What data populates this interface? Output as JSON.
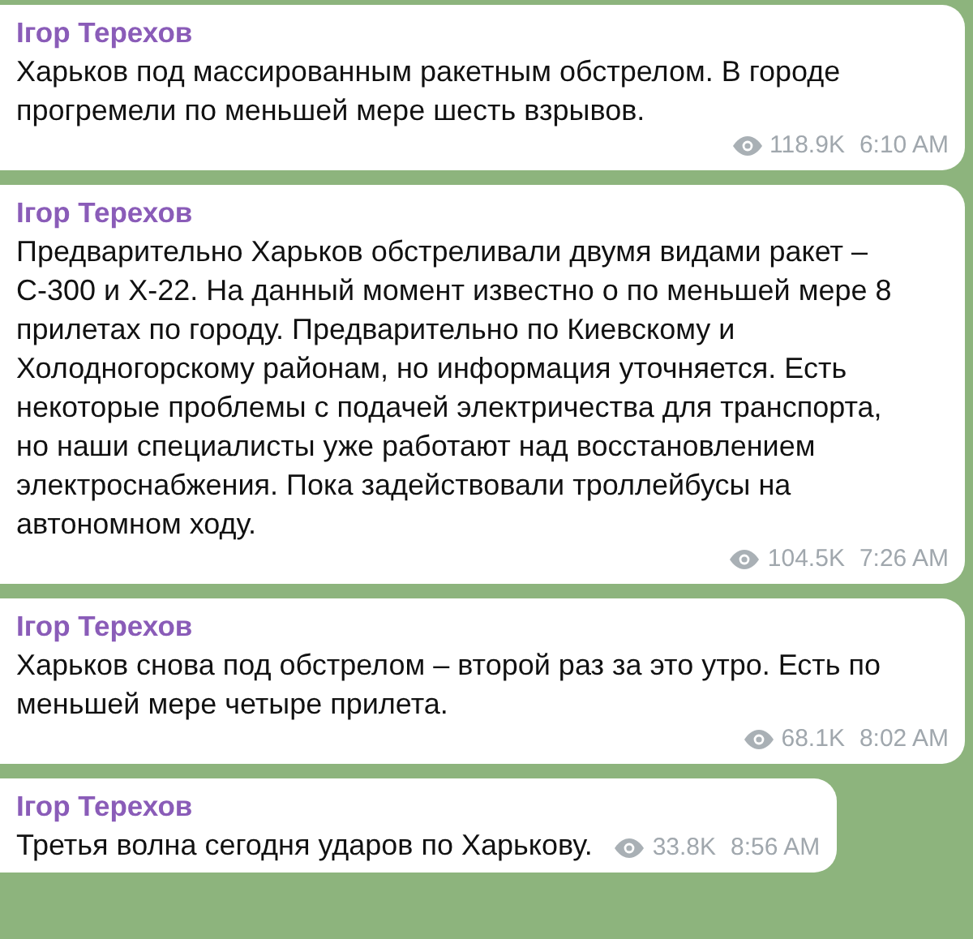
{
  "messages": [
    {
      "author": "Ігор Терехов",
      "text": "Харьков под массированным ракетным обстрелом. В городе\nпрогремели по меньшей мере шесть взрывов.",
      "views": "118.9K",
      "time": "6:10 AM"
    },
    {
      "author": "Ігор Терехов",
      "text": "Предварительно Харьков обстреливали двумя видами ракет –\nС-300 и Х-22. На данный момент известно о по меньшей мере 8\nприлетах по городу. Предварительно по Киевскому и\nХолодногорскому районам, но информация уточняется. Есть\nнекоторые проблемы с подачей электричества для транспорта,\nно наши специалисты уже работают над восстановлением\nэлектроснабжения. Пока задействовали троллейбусы на\nавтономном ходу.",
      "views": "104.5K",
      "time": "7:26 AM"
    },
    {
      "author": "Ігор Терехов",
      "text": "Харьков снова под обстрелом – второй раз за это утро. Есть по\nменьшей мере четыре прилета.",
      "views": "68.1K",
      "time": "8:02 AM"
    },
    {
      "author": "Ігор Терехов",
      "text": "Третья волна сегодня ударов по Харькову.",
      "views": "33.8K",
      "time": "8:56 AM"
    }
  ]
}
